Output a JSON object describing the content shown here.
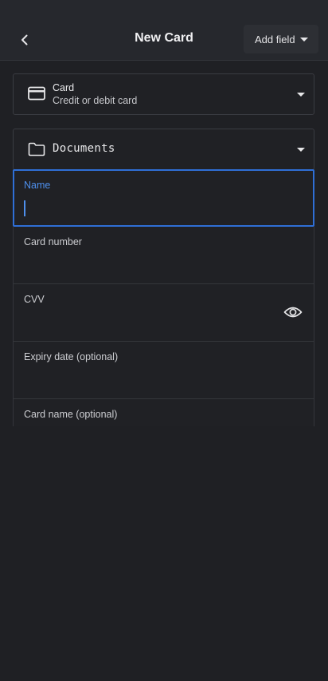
{
  "header": {
    "title": "New Card",
    "add_field_label": "Add field"
  },
  "type_select": {
    "title": "Card",
    "subtitle": "Credit or debit card",
    "icon": "credit-card-icon"
  },
  "folder_select": {
    "label": "Documents",
    "icon": "folder-icon"
  },
  "fields": {
    "name": {
      "label": "Name",
      "value": ""
    },
    "card_number": {
      "label": "Card number",
      "value": ""
    },
    "cvv": {
      "label": "CVV",
      "value": "",
      "icon": "eye-icon"
    },
    "expiry": {
      "label": "Expiry date (optional)",
      "value": ""
    },
    "card_name": {
      "label": "Card name (optional)",
      "value": ""
    }
  },
  "colors": {
    "background": "#1f2024",
    "header": "#26282d",
    "accent": "#2f6fd6"
  }
}
